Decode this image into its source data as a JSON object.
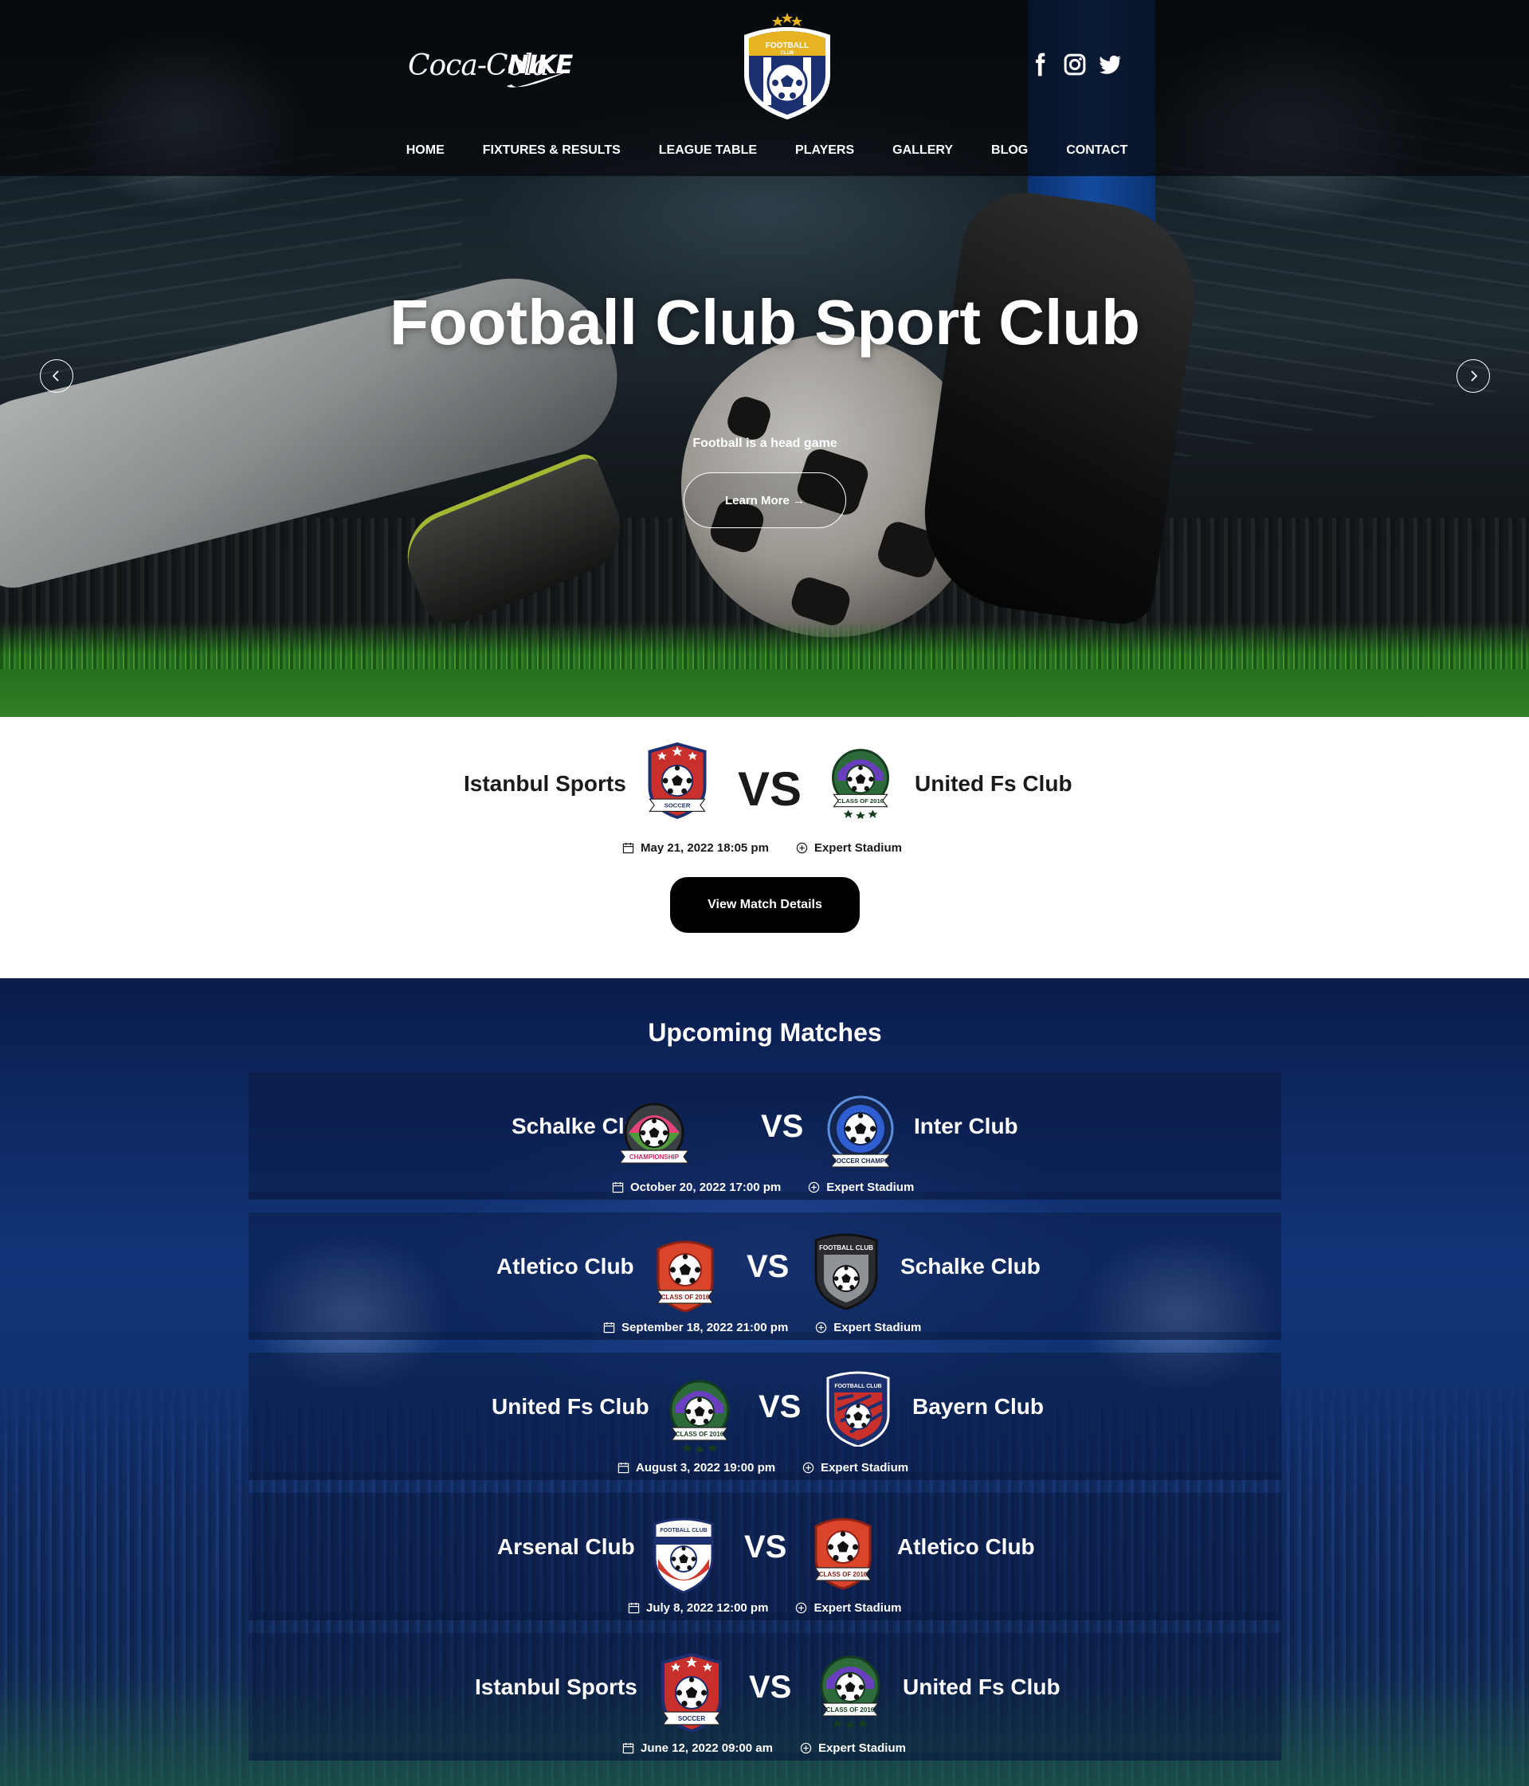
{
  "header": {
    "sponsors": [
      "Coca-Cola",
      "NIKE"
    ],
    "logo_text": "FOOTBALL CLUB",
    "nav": [
      "HOME",
      "FIXTURES & RESULTS",
      "LEAGUE TABLE",
      "PLAYERS",
      "GALLERY",
      "BLOG",
      "CONTACT"
    ],
    "social_icons": [
      "facebook-icon",
      "instagram-icon",
      "twitter-icon"
    ]
  },
  "hero": {
    "title": "Football Club Sport Club",
    "subtitle": "Football is a head game",
    "button": "Learn More →"
  },
  "featured": {
    "home": "Istanbul Sports",
    "away": "United Fs Club",
    "vs": "VS",
    "home_badge": "SOCCER",
    "away_badge": "CLASS OF 2016",
    "date": "May 21, 2022 18:05 pm",
    "venue": "Expert Stadium",
    "button": "View Match Details"
  },
  "upcoming": {
    "title": "Upcoming Matches",
    "matches": [
      {
        "home": "Schalke Club",
        "away": "Inter Club",
        "vs": "VS",
        "home_badge": "CHAMPIONSHIP",
        "away_badge": "SOCCER CHAMPS",
        "date": "October 20, 2022 17:00 pm",
        "venue": "Expert Stadium"
      },
      {
        "home": "Atletico Club",
        "away": "Schalke Club",
        "vs": "VS",
        "home_badge": "CLASS OF 2016",
        "away_badge": "FOOTBALL CLUB",
        "date": "September 18, 2022 21:00 pm",
        "venue": "Expert Stadium"
      },
      {
        "home": "United Fs Club",
        "away": "Bayern Club",
        "vs": "VS",
        "home_badge": "CLASS OF 2016",
        "away_badge": "FOOTBALL CLUB",
        "date": "August 3, 2022 19:00 pm",
        "venue": "Expert Stadium"
      },
      {
        "home": "Arsenal Club",
        "away": "Atletico Club",
        "vs": "VS",
        "home_badge": "FOOTBALL CLUB",
        "away_badge": "CLASS OF 2016",
        "date": "July 8, 2022 12:00 pm",
        "venue": "Expert Stadium"
      },
      {
        "home": "Istanbul Sports",
        "away": "United Fs Club",
        "vs": "VS",
        "home_badge": "SOCCER",
        "away_badge": "CLASS OF 2016",
        "date": "June 12, 2022 09:00 am",
        "venue": "Expert Stadium"
      }
    ]
  },
  "colors": {
    "brand_navy": "#1c2f6e",
    "brand_gold": "#e8b322",
    "upcoming_bg": "#0f2c6a",
    "button_black": "#000000"
  }
}
